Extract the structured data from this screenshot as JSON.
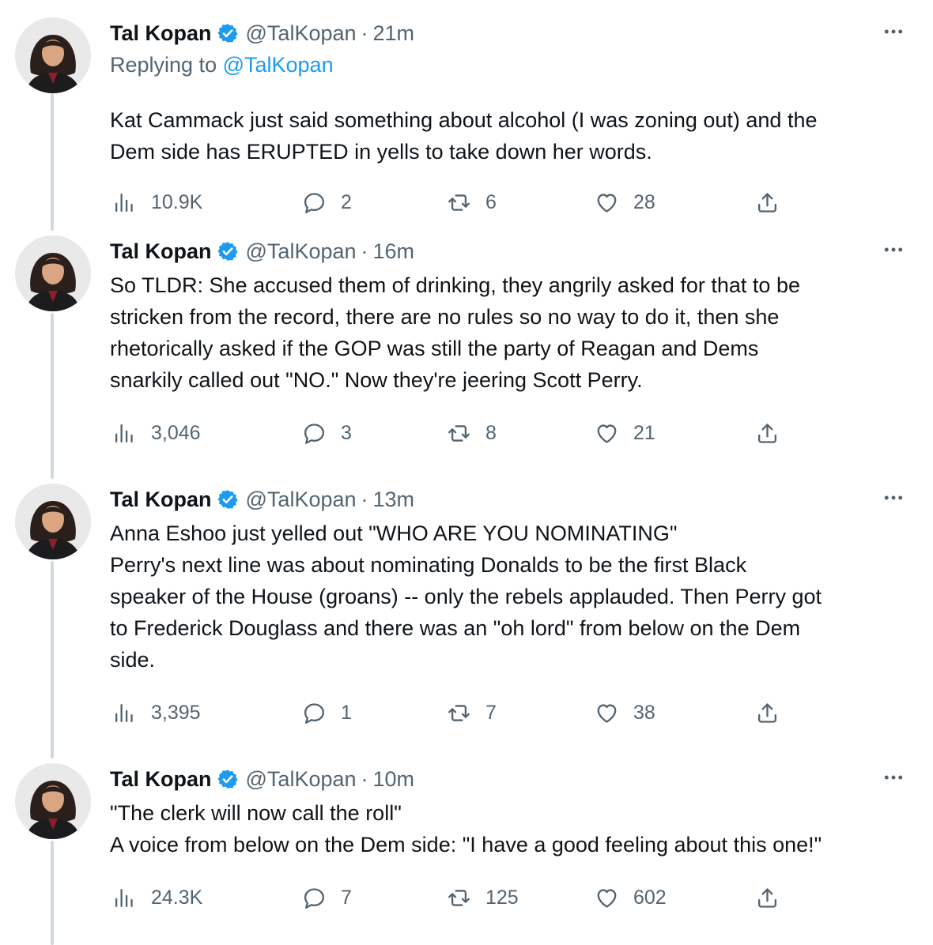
{
  "tweets": [
    {
      "name": "Tal Kopan",
      "handle": "@TalKopan",
      "separator": "·",
      "time": "21m",
      "replying_prefix": "Replying to ",
      "replying_handle": "@TalKopan",
      "text": "Kat Cammack just said something about alcohol (I was zoning out) and the\nDem side has ERUPTED in yells to take down her words.",
      "views": "10.9K",
      "replies": "2",
      "retweets": "6",
      "likes": "28"
    },
    {
      "name": "Tal Kopan",
      "handle": "@TalKopan",
      "separator": "·",
      "time": "16m",
      "text": "So TLDR: She accused them of drinking, they angrily asked for that to be\nstricken from the record, there are no rules so no way to do it, then she\nrhetorically asked if the GOP was still the party of Reagan and Dems\nsnarkily called out \"NO.\" Now they're jeering Scott Perry.",
      "views": "3,046",
      "replies": "3",
      "retweets": "8",
      "likes": "21"
    },
    {
      "name": "Tal Kopan",
      "handle": "@TalKopan",
      "separator": "·",
      "time": "13m",
      "text": "Anna Eshoo just yelled out \"WHO ARE YOU NOMINATING\"\nPerry's next line was about nominating Donalds to be the first Black\nspeaker of the House (groans) -- only the rebels applauded. Then Perry got\nto Frederick Douglass and there was an \"oh lord\" from below on the Dem\nside.",
      "views": "3,395",
      "replies": "1",
      "retweets": "7",
      "likes": "38"
    },
    {
      "name": "Tal Kopan",
      "handle": "@TalKopan",
      "separator": "·",
      "time": "10m",
      "text": "\"The clerk will now call the roll\"\nA voice from below on the Dem side: \"I have a good feeling about this one!\"",
      "views": "24.3K",
      "replies": "7",
      "retweets": "125",
      "likes": "602"
    }
  ],
  "icons": {
    "views": "views-bar-chart-icon",
    "reply": "reply-bubble-icon",
    "retweet": "retweet-arrows-icon",
    "like": "heart-icon",
    "share": "share-upload-icon",
    "more": "more-dots-icon",
    "verified": "verified-badge-icon"
  },
  "colors": {
    "text": "#0f1419",
    "secondary": "#536471",
    "link": "#1d9bf0",
    "thread_line": "#cfd9de"
  }
}
